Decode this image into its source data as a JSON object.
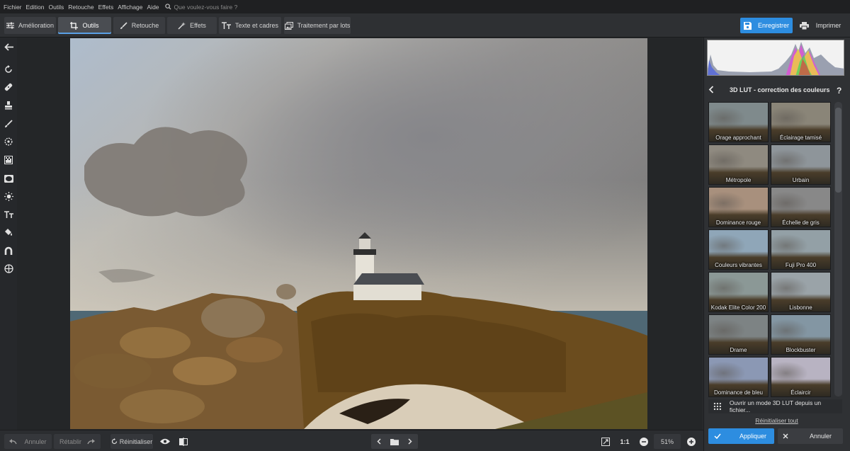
{
  "menu": {
    "items": [
      "Fichier",
      "Edition",
      "Outils",
      "Retouche",
      "Effets",
      "Affichage",
      "Aide"
    ],
    "search_placeholder": "Que voulez-vous faire ?"
  },
  "toolbar": {
    "tabs": [
      {
        "label": "Amélioration",
        "icon": "sliders-icon"
      },
      {
        "label": "Outils",
        "icon": "crop-icon"
      },
      {
        "label": "Retouche",
        "icon": "brush-icon"
      },
      {
        "label": "Effets",
        "icon": "magic-wand-icon"
      },
      {
        "label": "Texte et cadres",
        "icon": "text-icon"
      },
      {
        "label": "Traitement par lots",
        "icon": "batch-images-icon"
      }
    ],
    "active_tab": "Outils",
    "save_label": "Enregistrer",
    "print_label": "Imprimer"
  },
  "left_tools": [
    "back-arrow-icon",
    "rotate-icon",
    "healing-patch-icon",
    "stamp-icon",
    "brush-icon",
    "target-icon",
    "gradient-icon",
    "vignette-icon",
    "sun-icon",
    "text-icon",
    "fill-bucket-icon",
    "magnet-icon",
    "globe-icon"
  ],
  "panel": {
    "title": "3D LUT - correction des couleurs",
    "help": "?",
    "luts": [
      {
        "label": "Orage approchant",
        "tint": "#7f8a8c"
      },
      {
        "label": "Éclairage tamisé",
        "tint": "#8a8578"
      },
      {
        "label": "Métropole",
        "tint": "#8f8a80"
      },
      {
        "label": "Urbain",
        "tint": "#8e959a"
      },
      {
        "label": "Dominance rouge",
        "tint": "#a8907d"
      },
      {
        "label": "Échelle de gris",
        "tint": "#888888"
      },
      {
        "label": "Couleurs vibrantes",
        "tint": "#8fa6b8"
      },
      {
        "label": "Fuji Pro 400",
        "tint": "#93a0a6"
      },
      {
        "label": "Kodak Elite Color 200",
        "tint": "#8b9896"
      },
      {
        "label": "Lisbonne",
        "tint": "#9aa3a8"
      },
      {
        "label": "Drame",
        "tint": "#7d8384"
      },
      {
        "label": "Blockbuster",
        "tint": "#8396a3"
      },
      {
        "label": "Dominance de bleu",
        "tint": "#8b98b4"
      },
      {
        "label": "Éclaircir",
        "tint": "#b8b3c2"
      }
    ],
    "open_lut_label": "Ouvrir un mode 3D LUT depuis un fichier...",
    "reset_all_label": "Réinitialiser tout",
    "apply_label": "Appliquer",
    "cancel_label": "Annuler"
  },
  "bottom": {
    "undo_label": "Annuler",
    "redo_label": "Rétablir",
    "reset_label": "Réinitialiser",
    "ratio_label": "1:1",
    "zoom_value": "51%"
  },
  "colors": {
    "accent": "#2d8de0",
    "bg": "#2b2d30"
  }
}
